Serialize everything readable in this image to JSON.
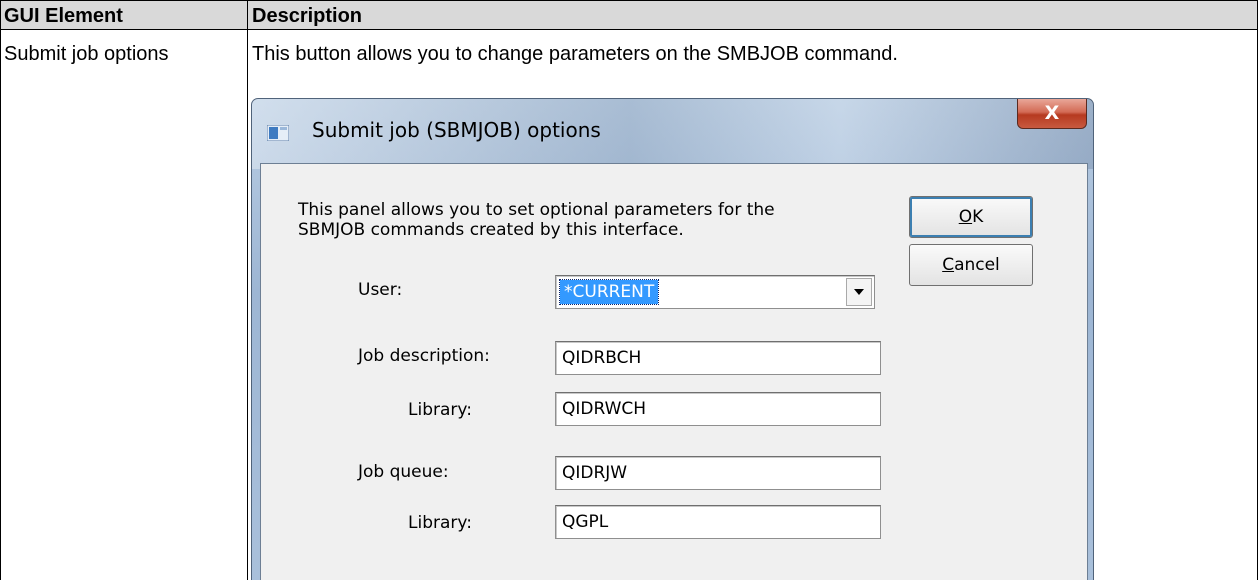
{
  "table": {
    "headers": [
      "GUI Element",
      "Description"
    ],
    "row": {
      "element": "Submit job options",
      "description": "This button allows you to change parameters on the SMBJOB command."
    }
  },
  "dialog": {
    "title": "Submit job (SBMJOB) options",
    "close_glyph": "X",
    "intro_text": "This panel allows you to set optional parameters for the\nSBMJOB commands created by this interface.",
    "buttons": {
      "ok": {
        "mnemonic": "O",
        "rest": "K"
      },
      "cancel": {
        "mnemonic": "C",
        "rest": "ancel"
      }
    },
    "fields": {
      "user": {
        "label": "User:",
        "value": "*CURRENT"
      },
      "job_description": {
        "label": "Job description:",
        "value": "QIDRBCH"
      },
      "job_description_library": {
        "label": "Library:",
        "value": "QIDRWCH"
      },
      "job_queue": {
        "label": "Job queue:",
        "value": "QIDRJW"
      },
      "job_queue_library": {
        "label": "Library:",
        "value": "QGPL"
      }
    },
    "icons": {
      "app": "window-app-icon",
      "close": "close-icon",
      "dropdown": "chevron-down-icon"
    },
    "colors": {
      "selection": "#3399ff",
      "close_button": "#c85a40",
      "header_row": "#d9d9d9"
    }
  }
}
